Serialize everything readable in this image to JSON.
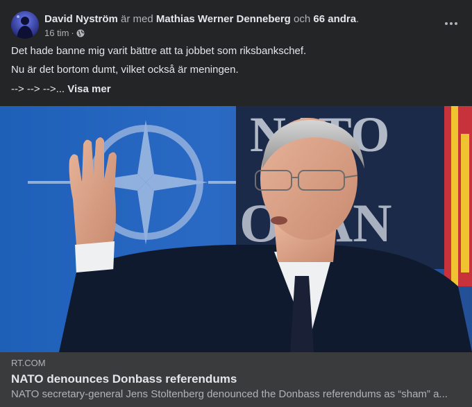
{
  "post": {
    "author": "David Nyström",
    "with_prefix": "är med",
    "tagged": "Mathias Werner Denneberg",
    "and_word": "och",
    "others": "66 andra",
    "period": ".",
    "time": "16 tim",
    "dot": "·",
    "privacy_icon": "globe-icon",
    "more_icon": "ellipsis-icon",
    "line1": "Det hade banne mig varit bättre att ta jobbet som riksbankschef.",
    "line2": "Nu är det bortom dumt, vilket också är meningen.",
    "line3_prefix": "--> --> -->...",
    "see_more": "Visa mer"
  },
  "image": {
    "nato_text_1": "NATO",
    "nato_text_2": "OTAN"
  },
  "link": {
    "domain": "RT.COM",
    "title": "NATO denounces Donbass referendums",
    "description": "NATO secretary-general Jens Stoltenberg denounced the Donbass referendums as “sham” a..."
  },
  "colors": {
    "card_bg": "#242526",
    "link_bg": "#3a3b3c",
    "text_primary": "#e4e6eb",
    "text_secondary": "#b0b3b8"
  }
}
